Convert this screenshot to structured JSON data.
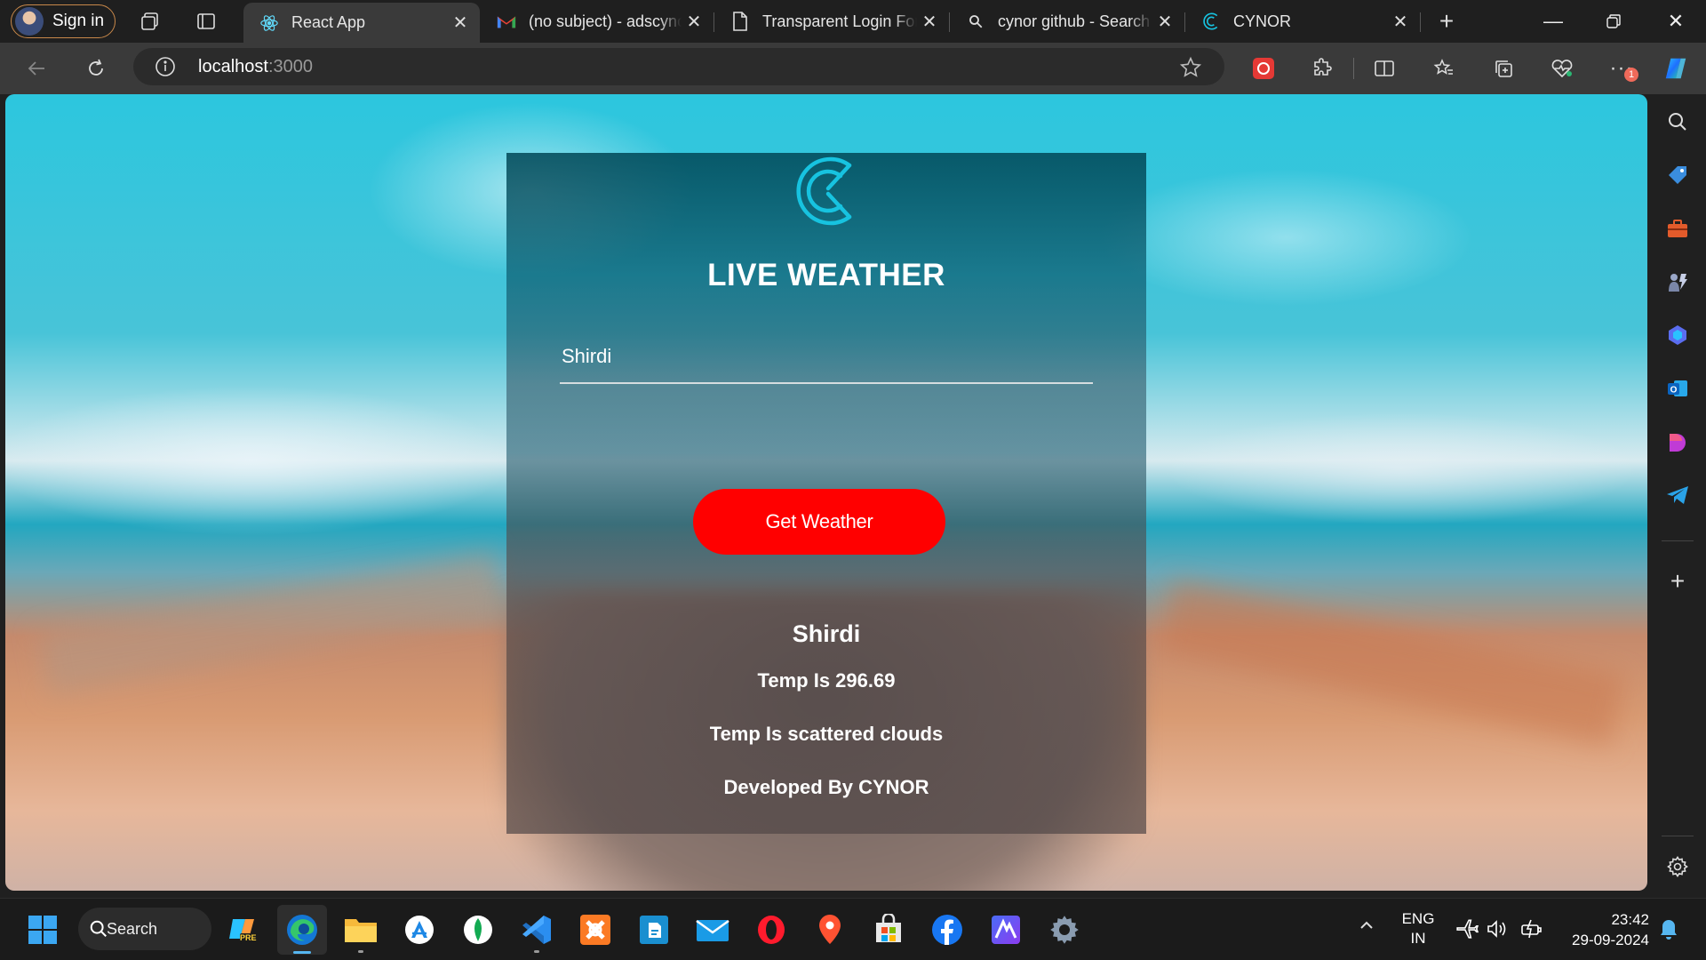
{
  "browser": {
    "profile_label": "Sign in",
    "tabs": [
      {
        "title": "React App",
        "icon": "react-icon",
        "active": true
      },
      {
        "title": "(no subject) - adscynor",
        "icon": "gmail-icon",
        "active": false
      },
      {
        "title": "Transparent Login Form",
        "icon": "page-icon",
        "active": false
      },
      {
        "title": "cynor github - Search",
        "icon": "search-icon",
        "active": false
      },
      {
        "title": "CYNOR",
        "icon": "cynor-icon",
        "active": false
      }
    ],
    "url_host": "localhost",
    "url_port": ":3000",
    "notification_count": "1"
  },
  "app": {
    "title": "LIVE WEATHER",
    "input_value": "Shirdi",
    "input_placeholder": "",
    "button_label": "Get Weather",
    "city": "Shirdi",
    "temp_line": "Temp Is 296.69",
    "desc_line": "Temp Is scattered clouds",
    "credit": "Developed By CYNOR"
  },
  "taskbar": {
    "search_label": "Search",
    "lang": "ENG",
    "region": "IN",
    "time": "23:42",
    "date": "29-09-2024",
    "copilot_badge": "PRE"
  },
  "colors": {
    "accent_button": "#ff0000",
    "card_top": "#00465a",
    "logo": "#17c3e0"
  }
}
